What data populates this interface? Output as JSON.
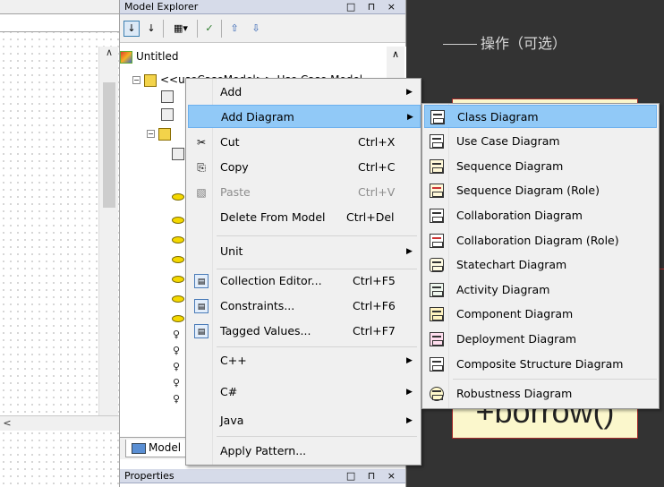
{
  "model_explorer": {
    "title": "Model Explorer",
    "controls": "□ ⊓ ×",
    "tree": {
      "root": "Untitled",
      "model": "<<useCaseModel>> Use Case Model"
    },
    "tab_label": "Model"
  },
  "properties": {
    "title": "Properties",
    "controls": "□ ⊓ ×"
  },
  "diagram": {
    "label": "操作（可选）",
    "operation_text": "+borrow()"
  },
  "context_menu": {
    "items": [
      {
        "label": "Add",
        "shortcut": "",
        "submenu": true
      },
      {
        "label": "Add Diagram",
        "shortcut": "",
        "submenu": true
      },
      {
        "label": "Cut",
        "shortcut": "Ctrl+X"
      },
      {
        "label": "Copy",
        "shortcut": "Ctrl+C"
      },
      {
        "label": "Paste",
        "shortcut": "Ctrl+V",
        "disabled": true
      },
      {
        "label": "Delete From Model",
        "shortcut": "Ctrl+Del"
      },
      {
        "label": "Unit",
        "shortcut": "",
        "submenu": true
      },
      {
        "label": "Collection Editor...",
        "shortcut": "Ctrl+F5"
      },
      {
        "label": "Constraints...",
        "shortcut": "Ctrl+F6"
      },
      {
        "label": "Tagged Values...",
        "shortcut": "Ctrl+F7"
      },
      {
        "label": "C++",
        "shortcut": "",
        "submenu": true
      },
      {
        "label": "C#",
        "shortcut": "",
        "submenu": true
      },
      {
        "label": "Java",
        "shortcut": "",
        "submenu": true
      },
      {
        "label": "Apply Pattern...",
        "shortcut": ""
      }
    ]
  },
  "diagram_submenu": {
    "items": [
      "Class Diagram",
      "Use Case Diagram",
      "Sequence Diagram",
      "Sequence Diagram (Role)",
      "Collaboration Diagram",
      "Collaboration Diagram (Role)",
      "Statechart Diagram",
      "Activity Diagram",
      "Component Diagram",
      "Deployment Diagram",
      "Composite Structure Diagram",
      "Robustness Diagram"
    ]
  },
  "colors": {
    "highlight": "#91c9f7",
    "menu_bg": "#f0f0f0",
    "dark_bg": "#333333"
  }
}
